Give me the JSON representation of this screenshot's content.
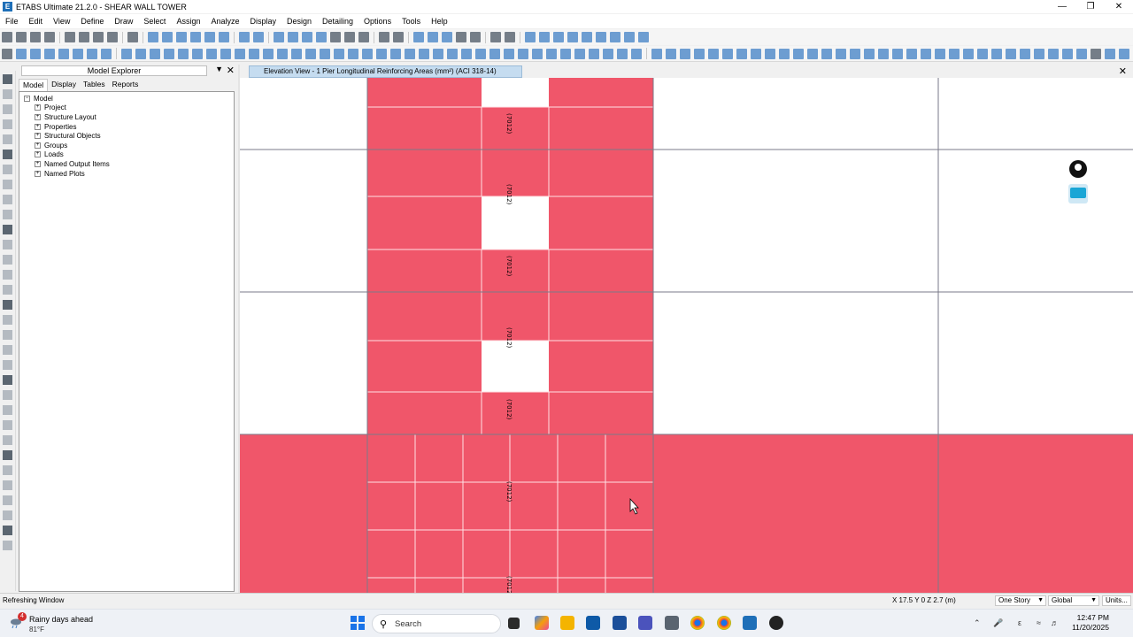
{
  "window": {
    "title": "ETABS Ultimate 21.2.0 - SHEAR WALL TOWER",
    "logo": "E"
  },
  "menu": [
    "File",
    "Edit",
    "View",
    "Define",
    "Draw",
    "Select",
    "Assign",
    "Analyze",
    "Display",
    "Design",
    "Detailing",
    "Options",
    "Tools",
    "Help"
  ],
  "explorer": {
    "title": "Model Explorer",
    "tabs": [
      "Model",
      "Display",
      "Tables",
      "Reports"
    ],
    "root": "Model",
    "items": [
      "Project",
      "Structure Layout",
      "Properties",
      "Structural Objects",
      "Groups",
      "Loads",
      "Named Output Items",
      "Named Plots"
    ]
  },
  "view": {
    "tab_title": "Elevation View - 1  Pier Longitudinal Reinforcing Areas (mm²)  (ACI 318-14)",
    "pier_label": "(7012)",
    "colors": {
      "pier_fill": "#f0566a",
      "gridline": "#7a7a88",
      "pier_edge": "#ffe0e4"
    }
  },
  "statusbar": {
    "message": "Refreshing Window",
    "coords": "X 17.5  Y 0  Z 2.7 (m)",
    "story": "One Story",
    "coord_system": "Global",
    "units": "Units..."
  },
  "taskbar": {
    "weather_title": "Rainy days ahead",
    "weather_temp": "81°F",
    "weather_badge": "4",
    "search_placeholder": "Search",
    "time": "12:47 PM",
    "date": "11/20/2025"
  }
}
